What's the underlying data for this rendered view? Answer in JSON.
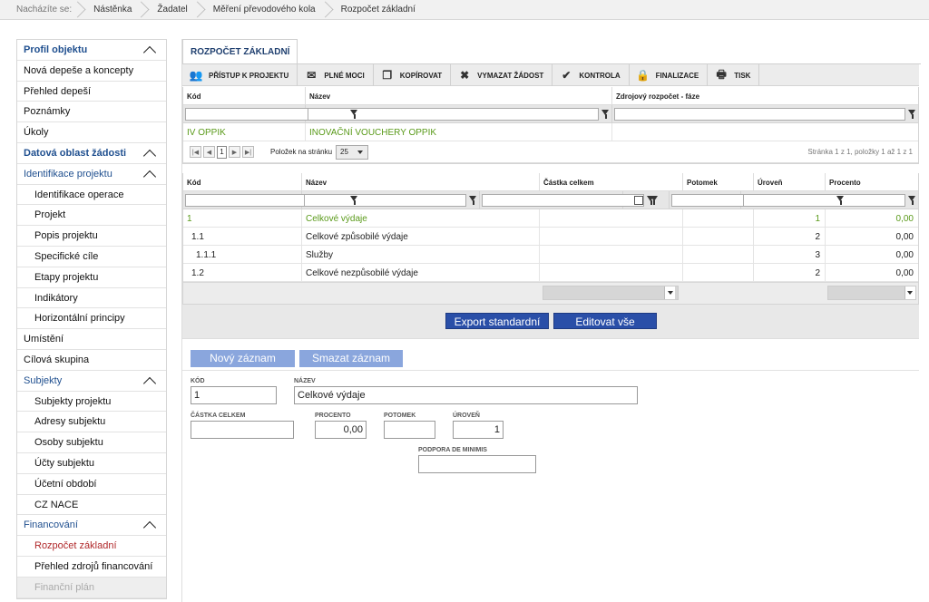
{
  "breadcrumb": {
    "label": "Nacházíte se:",
    "items": [
      "Nástěnka",
      "Žadatel",
      "Měření převodového kola",
      "Rozpočet základní"
    ]
  },
  "sidebar": {
    "items": [
      {
        "label": "Profil objektu",
        "type": "sec",
        "expanded": true
      },
      {
        "label": "Nová depeše a koncepty",
        "type": "item"
      },
      {
        "label": "Přehled depeší",
        "type": "item"
      },
      {
        "label": "Poznámky",
        "type": "item"
      },
      {
        "label": "Úkoly",
        "type": "item"
      },
      {
        "label": "Datová oblast žádosti",
        "type": "sec",
        "expanded": true
      },
      {
        "label": "Identifikace projektu",
        "type": "sec2",
        "expanded": true
      },
      {
        "label": "Identifikace operace",
        "type": "sub"
      },
      {
        "label": "Projekt",
        "type": "sub"
      },
      {
        "label": "Popis projektu",
        "type": "sub"
      },
      {
        "label": "Specifické cíle",
        "type": "sub"
      },
      {
        "label": "Etapy projektu",
        "type": "sub"
      },
      {
        "label": "Indikátory",
        "type": "sub"
      },
      {
        "label": "Horizontální principy",
        "type": "sub"
      },
      {
        "label": "Umístění",
        "type": "item"
      },
      {
        "label": "Cílová skupina",
        "type": "item"
      },
      {
        "label": "Subjekty",
        "type": "sec2",
        "expanded": true
      },
      {
        "label": "Subjekty projektu",
        "type": "sub"
      },
      {
        "label": "Adresy subjektu",
        "type": "sub"
      },
      {
        "label": "Osoby subjektu",
        "type": "sub"
      },
      {
        "label": "Účty subjektu",
        "type": "sub"
      },
      {
        "label": "Účetní období",
        "type": "sub"
      },
      {
        "label": "CZ NACE",
        "type": "sub"
      },
      {
        "label": "Financování",
        "type": "sec2",
        "expanded": true
      },
      {
        "label": "Rozpočet základní",
        "type": "sub active"
      },
      {
        "label": "Přehled zdrojů financování",
        "type": "sub"
      },
      {
        "label": "Finanční plán",
        "type": "sub dim"
      }
    ]
  },
  "tab": {
    "label": "ROZPOČET ZÁKLADNÍ"
  },
  "toolbar": [
    {
      "label": "PŘÍSTUP K PROJEKTU",
      "icon": "people-icon"
    },
    {
      "label": "PLNÉ MOCI",
      "icon": "envelope-icon"
    },
    {
      "label": "KOPÍROVAT",
      "icon": "copy-icon"
    },
    {
      "label": "VYMAZAT ŽÁDOST",
      "icon": "x-icon"
    },
    {
      "label": "KONTROLA",
      "icon": "check-icon"
    },
    {
      "label": "FINALIZACE",
      "icon": "lock-icon"
    },
    {
      "label": "TISK",
      "icon": "printer-icon"
    }
  ],
  "grid1": {
    "headers": [
      "Kód",
      "Název",
      "Zdrojový rozpočet - fáze"
    ],
    "row": [
      "IV OPPIK",
      "INOVAČNÍ VOUCHERY OPPIK",
      ""
    ]
  },
  "pager": {
    "page": "1",
    "per_page_label": "Položek na stránku",
    "per_page": "25",
    "info": "Stránka 1 z 1, položky 1 až 1 z 1"
  },
  "grid2": {
    "headers": [
      "Kód",
      "Název",
      "Částka celkem",
      "Potomek",
      "Úroveň",
      "Procento"
    ],
    "rows": [
      {
        "kod": "1",
        "nazev": "Celkové výdaje",
        "castka": "",
        "potomek": "",
        "uroven": "1",
        "procento": "0,00",
        "green": true
      },
      {
        "kod": "1.1",
        "nazev": "Celkové způsobilé výdaje",
        "castka": "",
        "potomek": "",
        "uroven": "2",
        "procento": "0,00",
        "green": false
      },
      {
        "kod": "1.1.1",
        "nazev": "Služby",
        "castka": "",
        "potomek": "",
        "uroven": "3",
        "procento": "0,00",
        "green": false
      },
      {
        "kod": "1.2",
        "nazev": "Celkové nezpůsobilé výdaje",
        "castka": "",
        "potomek": "",
        "uroven": "2",
        "procento": "0,00",
        "green": false
      }
    ]
  },
  "buttons": {
    "export": "Export standardní",
    "edit_all": "Editovat vše",
    "new": "Nový záznam",
    "delete": "Smazat záznam"
  },
  "form": {
    "kod_label": "KÓD",
    "kod": "1",
    "nazev_label": "NÁZEV",
    "nazev": "Celkové výdaje",
    "castka_label": "ČÁSTKA CELKEM",
    "castka": "",
    "procento_label": "PROCENTO",
    "procento": "0,00",
    "potomek_label": "POTOMEK",
    "potomek": "",
    "uroven_label": "ÚROVEŇ",
    "uroven": "1",
    "podpora_label": "PODPORA DE MINIMIS",
    "podpora": ""
  }
}
